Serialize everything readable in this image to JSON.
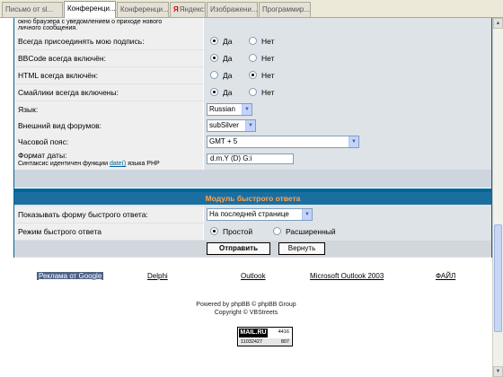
{
  "tabs": [
    {
      "label": "Письмо от sl..."
    },
    {
      "label": "Конференци..."
    },
    {
      "label": "Конференци..."
    },
    {
      "label": "Яндекс: ..."
    },
    {
      "label": "Изображени..."
    },
    {
      "label": "Программир..."
    }
  ],
  "top_note": [
    "окно браузера с уведомлением о приходе нового",
    "личного сообщения."
  ],
  "radio_yes": "Да",
  "radio_no": "Нет",
  "rows": [
    {
      "label": "Всегда присоединять мою подпись:",
      "yes_selected": true
    },
    {
      "label": "BBCode всегда включён:",
      "yes_selected": true
    },
    {
      "label": "HTML всегда включён:",
      "yes_selected": false
    },
    {
      "label": "Смайлики всегда включены:",
      "yes_selected": true
    }
  ],
  "language": {
    "label": "Язык:",
    "value": "Russian"
  },
  "style": {
    "label": "Внешний вид форумов:",
    "value": "subSilver"
  },
  "timezone": {
    "label": "Часовой пояс:",
    "value": "GMT + 5"
  },
  "dateformat": {
    "label": "Формат даты:",
    "hint_pre": "Синтаксис идентичен функции ",
    "hint_link": "date()",
    "hint_post": " языка PHP",
    "value": "d.m.Y (D) G:i"
  },
  "quickreply": {
    "title": "Модуль быстрого ответа",
    "show_label": "Показывать форму быстрого ответа:",
    "show_value": "На последней странице",
    "mode_label": "Режим быстрого ответа",
    "mode_simple": "Простой",
    "mode_advanced": "Расширенный"
  },
  "buttons": {
    "submit": "Отправить",
    "reset": "Вернуть"
  },
  "links": [
    "Реклама от Google",
    "Delphi",
    "Outlook",
    "Microsoft Outlook 2003",
    "ФАЙЛ"
  ],
  "footer": {
    "line1": "Powered by phpBB © phpBB Group",
    "line2": "Copyright © VBStreets"
  },
  "counter": {
    "logo": "MAIL.RU",
    "n1": "4416",
    "n2": "11032427",
    "n3": "807"
  }
}
